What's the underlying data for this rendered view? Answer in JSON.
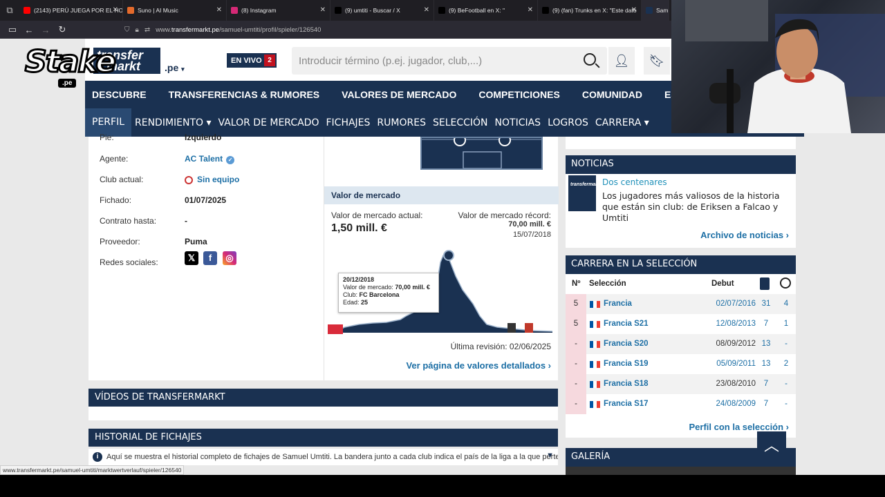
{
  "browser": {
    "tabs": [
      {
        "title": "(2143) PERÚ JUEGA POR EL HO",
        "fav": "#ff0000"
      },
      {
        "title": "Suno | AI Music",
        "fav": "#e46a2b"
      },
      {
        "title": "(8) Instagram",
        "fav": "#d62976"
      },
      {
        "title": "(9) umtiti - Buscar / X",
        "fav": "#000000"
      },
      {
        "title": "(9) BeFootball en X: \"",
        "fav": "#000000"
      },
      {
        "title": "(9) (fan) Trunks en X: \"Este dato",
        "fav": "#000000"
      },
      {
        "title": "Samu",
        "fav": "#1a3151"
      }
    ],
    "url_prefix": "www.",
    "url_host": "transfermarkt.pe",
    "url_path": "/samuel-umtiti/profil/spieler/126540",
    "status_url": "www.transfermarkt.pe/samuel-umtiti/marktwertverlauf/spieler/126540"
  },
  "overlay": {
    "stake_word": "Stake",
    "stake_pe": ".pe"
  },
  "header": {
    "logo_line1": "transfer",
    "logo_line2": "markt",
    "domain": ".pe",
    "live_label": "EN VIVO",
    "live_count": "2",
    "search_placeholder": "Introducir término (p.ej. jugador, club,...)"
  },
  "mainnav": [
    "DESCUBRE",
    "TRANSFERENCIAS & RUMORES",
    "VALORES DE MERCADO",
    "COMPETICIONES",
    "COMUNIDAD",
    "ESTADÍST"
  ],
  "subnav": [
    "PERFIL",
    "RENDIMIENTO ▾",
    "VALOR DE MERCADO",
    "FICHAJES",
    "RUMORES",
    "SELECCIÓN",
    "NOTICIAS",
    "LOGROS",
    "CARRERA ▾"
  ],
  "profile": {
    "foot_label": "Pie:",
    "foot_value": "Izquierdo",
    "agent_label": "Agente:",
    "agent_value": "AC Talent",
    "club_label": "Club actual:",
    "club_value": "Sin equipo",
    "joined_label": "Fichado:",
    "joined_value": "01/07/2025",
    "contract_label": "Contrato hasta:",
    "contract_value": "-",
    "outfitter_label": "Proveedor:",
    "outfitter_value": "Puma",
    "social_label": "Redes sociales:"
  },
  "market_value": {
    "heading": "Valor de mercado",
    "current_label": "Valor de mercado actual:",
    "current_value": "1,50 mill. €",
    "record_label": "Valor de mercado récord:",
    "record_value": "70,00 mill. €",
    "record_date": "15/07/2018",
    "tooltip": {
      "date": "20/12/2018",
      "line1_label": "Valor de mercado:",
      "line1_value": "70,00 mill. €",
      "line2_label": "Club:",
      "line2_value": "FC Barcelona",
      "line3_label": "Edad:",
      "line3_value": "25"
    },
    "last_review": "Última revisión: 02/06/2025",
    "details_link": "Ver página de valores detallados  ›"
  },
  "videos_heading": "VÍDEOS DE TRANSFERMARKT",
  "history_heading": "HISTORIAL DE FICHAJES",
  "history_info": "Aquí se muestra el historial completo de fichajes de Samuel Umtiti. La bandera junto a cada club indica el país de la liga a la que pertenece el ...",
  "news": {
    "heading": "NOTICIAS",
    "thumb_text": "transfermarkt",
    "kicker": "Dos centenares",
    "title": "Los jugadores más valiosos de la historia que están sin club: de Eriksen a Falcao y Umtiti",
    "archive_link": "Archivo de noticias  ›"
  },
  "national": {
    "heading": "CARRERA EN LA SELECCIÓN",
    "col_no": "Nº",
    "col_team": "Selección",
    "col_debut": "Debut",
    "rows": [
      {
        "no": "5",
        "team": "Francia",
        "debut": "02/07/2016",
        "apps": "31",
        "goals": "4",
        "debut_link": true
      },
      {
        "no": "5",
        "team": "Francia S21",
        "debut": "12/08/2013",
        "apps": "7",
        "goals": "1",
        "debut_link": true
      },
      {
        "no": "-",
        "team": "Francia S20",
        "debut": "08/09/2012",
        "apps": "13",
        "goals": "-",
        "debut_link": false
      },
      {
        "no": "-",
        "team": "Francia S19",
        "debut": "05/09/2011",
        "apps": "13",
        "goals": "2",
        "debut_link": true
      },
      {
        "no": "-",
        "team": "Francia S18",
        "debut": "23/08/2010",
        "apps": "7",
        "goals": "-",
        "debut_link": false
      },
      {
        "no": "-",
        "team": "Francia S17",
        "debut": "24/08/2009",
        "apps": "7",
        "goals": "-",
        "debut_link": true
      }
    ],
    "profile_link": "Perfil con la selección  ›"
  },
  "gallery_heading": "GALERÍA"
}
